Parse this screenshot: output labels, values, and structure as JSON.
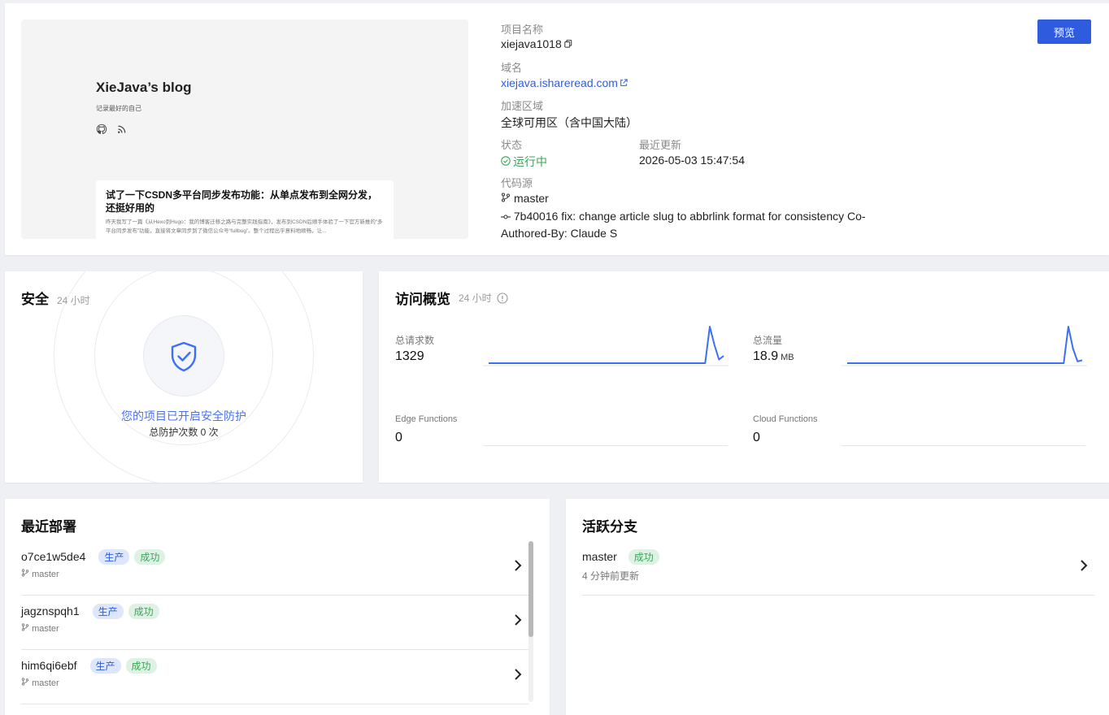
{
  "project": {
    "preview": {
      "blog_title": "XieJava’s blog",
      "blog_subtitle": "记录最好的自己",
      "post_title": "试了一下CSDN多平台同步发布功能：从单点发布到全网分发，还挺好用的",
      "post_excerpt": "昨天我写了一篇《从Hexo到Hugo：我的博客迁移之路与完整实践指南》，发布到CSDN后顺手体验了一下官方新推的“多平台同步发布”功能，直接将文章同步到了微信公众号“fullbug”。整个过程出乎意料地顺畅，让..."
    },
    "name_label": "项目名称",
    "name": "xiejava1018",
    "domain_label": "域名",
    "domain": "xiejava.ishareread.com",
    "region_label": "加速区域",
    "region": "全球可用区（含中国大陆）",
    "status_label": "状态",
    "status": "运行中",
    "updated_label": "最近更新",
    "updated": "2026-05-03 15:47:54",
    "source_label": "代码源",
    "branch": "master",
    "commit_line1": "7b40016 fix: change article slug to abbrlink format for consistency Co-",
    "commit_line2": "Authored-By: Claude S",
    "preview_button": "预览"
  },
  "security": {
    "title": "安全",
    "window": "24 小时",
    "status_text": "您的项目已开启安全防护",
    "count_text": "总防护次数 0 次"
  },
  "overview": {
    "title": "访问概览",
    "window": "24 小时",
    "metrics": [
      {
        "label": "总请求数",
        "value": "1329",
        "unit": ""
      },
      {
        "label": "总流量",
        "value": "18.9",
        "unit": "MB"
      },
      {
        "label": "Edge Functions",
        "value": "0",
        "unit": ""
      },
      {
        "label": "Cloud Functions",
        "value": "0",
        "unit": ""
      }
    ],
    "accent": "#3b6ff5"
  },
  "chart_data": [
    {
      "type": "line",
      "series": [
        {
          "values": [
            0,
            0,
            0,
            0,
            0,
            0,
            0,
            0,
            0,
            0,
            0,
            0,
            0,
            0,
            0,
            0,
            0,
            0,
            0,
            0,
            0,
            0,
            0,
            0,
            0,
            0,
            0,
            0,
            0,
            0,
            0,
            0,
            0,
            0,
            0,
            0,
            0,
            0,
            0,
            0,
            0,
            0,
            0,
            0,
            0,
            0,
            0,
            0,
            1.0,
            0.5,
            0.1,
            0.2
          ]
        }
      ],
      "title": "",
      "xlabel": "",
      "ylabel": "",
      "grid": false
    },
    {
      "type": "line",
      "series": [
        {
          "values": [
            0,
            0,
            0,
            0,
            0,
            0,
            0,
            0,
            0,
            0,
            0,
            0,
            0,
            0,
            0,
            0,
            0,
            0,
            0,
            0,
            0,
            0,
            0,
            0,
            0,
            0,
            0,
            0,
            0,
            0,
            0,
            0,
            0,
            0,
            0,
            0,
            0,
            0,
            0,
            0,
            0,
            0,
            0,
            0,
            0,
            0,
            0,
            0,
            1.0,
            0.4,
            0.05,
            0.08
          ]
        }
      ],
      "title": "",
      "xlabel": "",
      "ylabel": "",
      "grid": false
    }
  ],
  "deployments": {
    "title": "最近部署",
    "items": [
      {
        "id": "o7ce1w5de4",
        "env": "生产",
        "status": "成功",
        "branch": "master"
      },
      {
        "id": "jagznspqh1",
        "env": "生产",
        "status": "成功",
        "branch": "master"
      },
      {
        "id": "him6qi6ebf",
        "env": "生产",
        "status": "成功",
        "branch": "master"
      }
    ]
  },
  "branches": {
    "title": "活跃分支",
    "items": [
      {
        "name": "master",
        "status": "成功",
        "updated": "4 分钟前更新"
      }
    ]
  }
}
